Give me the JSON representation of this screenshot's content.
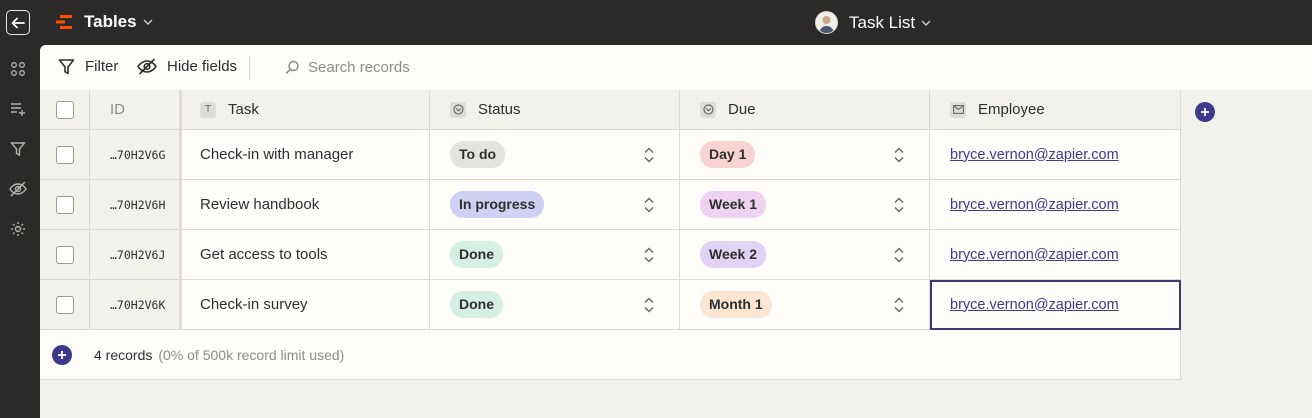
{
  "app": {
    "name": "Tables"
  },
  "document": {
    "title": "Task List"
  },
  "toolbar": {
    "filter_label": "Filter",
    "hide_fields_label": "Hide fields",
    "search_placeholder": "Search records"
  },
  "columns": {
    "id": "ID",
    "task": "Task",
    "status": "Status",
    "due": "Due",
    "employee": "Employee"
  },
  "rows": [
    {
      "id": "…70H2V6G",
      "task": "Check-in with manager",
      "status": "To do",
      "due": "Day 1",
      "employee": "bryce.vernon@zapier.com"
    },
    {
      "id": "…70H2V6H",
      "task": "Review handbook",
      "status": "In progress",
      "due": "Week 1",
      "employee": "bryce.vernon@zapier.com"
    },
    {
      "id": "…70H2V6J",
      "task": "Get access to tools",
      "status": "Done",
      "due": "Week 2",
      "employee": "bryce.vernon@zapier.com"
    },
    {
      "id": "…70H2V6K",
      "task": "Check-in survey",
      "status": "Done",
      "due": "Month 1",
      "employee": "bryce.vernon@zapier.com"
    }
  ],
  "pill_colors": {
    "To do": "#e5e3de",
    "In progress": "#cfd0f4",
    "Done": "#d6efe4",
    "Day 1": "#f8d3cf",
    "Week 1": "#efd2ef",
    "Week 2": "#e1d3f3",
    "Month 1": "#fbe6d3"
  },
  "footer": {
    "count": "4 records",
    "limit": "(0% of 500k record limit used)"
  },
  "colors": {
    "accent": "#3d3a8c",
    "brand": "#ff4f00",
    "topbar": "#2b2a28"
  }
}
